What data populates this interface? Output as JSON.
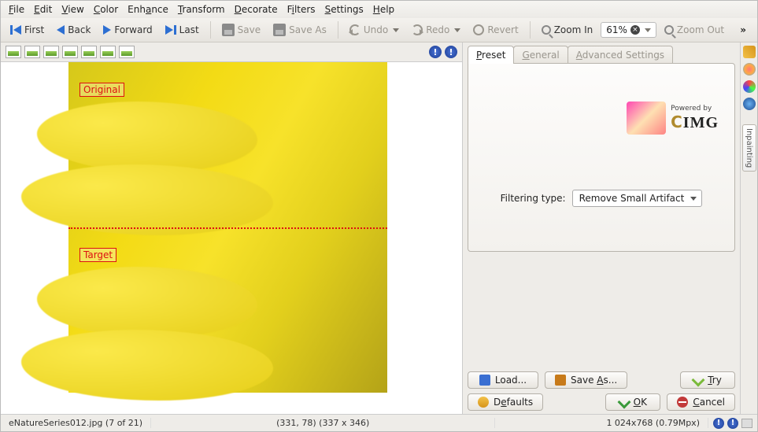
{
  "menu": [
    "File",
    "Edit",
    "View",
    "Color",
    "Enhance",
    "Transform",
    "Decorate",
    "Filters",
    "Settings",
    "Help"
  ],
  "toolbar": {
    "first": "First",
    "back": "Back",
    "forward": "Forward",
    "last": "Last",
    "save": "Save",
    "save_as": "Save As",
    "undo": "Undo",
    "redo": "Redo",
    "revert": "Revert",
    "zoom_in": "Zoom In",
    "zoom_out": "Zoom Out",
    "zoom_value": "61%"
  },
  "image": {
    "original_label": "Original",
    "target_label": "Target"
  },
  "right": {
    "tabs": {
      "preset": "Preset",
      "general": "General",
      "advanced": "Advanced Settings"
    },
    "powered_by": "Powered by",
    "logo_text": "CIMG",
    "filtering_type_label": "Filtering type:",
    "filtering_type_value": "Remove Small Artifact",
    "load": "Load...",
    "save_as": "Save As...",
    "try": "Try",
    "defaults": "Defaults",
    "ok": "OK",
    "cancel": "Cancel"
  },
  "sidebar": {
    "inpainting": "Inpainting"
  },
  "status": {
    "filename": "eNatureSeries012.jpg (7  of 21)",
    "coords": "(331, 78) (337 x 346)",
    "dims": "1 024x768 (0.79Mpx)"
  }
}
